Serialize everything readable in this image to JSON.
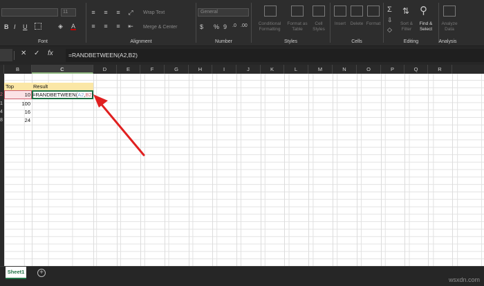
{
  "ribbon": {
    "groups": {
      "font": "Font",
      "alignment": "Alignment",
      "number": "Number",
      "styles": "Styles",
      "cells": "Cells",
      "editing": "Editing",
      "analysis": "Analysis"
    },
    "font_size": "11",
    "wrap_text": "Wrap Text",
    "merge_center": "Merge & Center",
    "number_format": "General",
    "conditional_formatting": [
      "Conditional",
      "Formatting"
    ],
    "format_as_table": [
      "Format as",
      "Table"
    ],
    "cell_styles": [
      "Cell",
      "Styles"
    ],
    "insert": "Insert",
    "delete": "Delete",
    "format": "Format",
    "sort_filter": [
      "Sort &",
      "Filter"
    ],
    "find_select": [
      "Find &",
      "Select"
    ],
    "analyze_data": [
      "Analyze",
      "Data"
    ],
    "bold": "B",
    "italic": "I",
    "underline": "U",
    "currency": "$",
    "percent": "%",
    "comma": "9",
    "autosum": "Σ"
  },
  "formula_bar": {
    "cancel": "✕",
    "enter": "✓",
    "fx": "fx",
    "value": "=RANDBETWEEN(A2,B2)"
  },
  "columns": [
    "B",
    "C",
    "D",
    "E",
    "F",
    "G",
    "H",
    "I",
    "J",
    "K",
    "L",
    "M",
    "N",
    "O",
    "P",
    "Q",
    "R"
  ],
  "cells": {
    "b1": "Top",
    "c1": "Result",
    "a_fragments": [
      "2",
      "1",
      "4",
      "8"
    ],
    "b_values": [
      "10",
      "100",
      "16",
      "24"
    ],
    "c2_formula_prefix": "=RANDBETWEEN(",
    "c2_ref1": "A2",
    "c2_comma": ",",
    "c2_ref2": "B2",
    "c2_close": ")"
  },
  "colors": {
    "ref1": "#7a9fd4",
    "ref2": "#cc5b6b",
    "selected_cell_border": "#1e7145",
    "header_fill": "#fbe7a6",
    "arrow": "#e02020"
  },
  "tabs": {
    "sheet1": "Sheet1",
    "add": "+"
  },
  "watermark": "wsxdn.com"
}
